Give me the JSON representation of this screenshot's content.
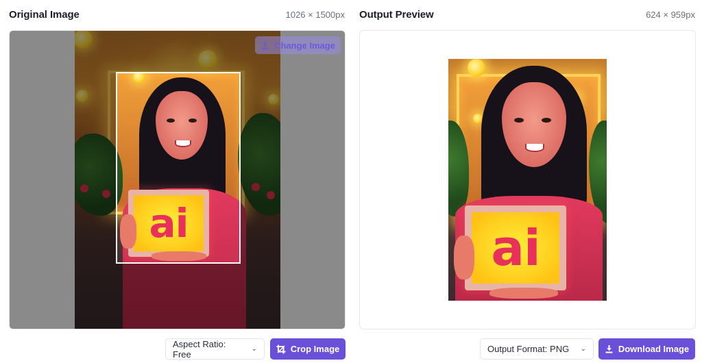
{
  "original": {
    "title": "Original Image",
    "dimensions": "1026 × 1500px",
    "change_button": "Change Image",
    "aspect_select": "Aspect Ratio: Free",
    "crop_button": "Crop Image"
  },
  "preview": {
    "title": "Output Preview",
    "dimensions": "624 × 959px",
    "format_select": "Output Format: PNG",
    "download_button": "Download Image"
  },
  "image_text": "ai",
  "colors": {
    "accent": "#6a4fd8",
    "sign_text": "#e8305a",
    "sign_bg": "#ffd21e"
  },
  "icons": {
    "upload": "upload-icon",
    "crop": "crop-icon",
    "download": "download-icon",
    "chevron": "chevron-down-icon"
  }
}
